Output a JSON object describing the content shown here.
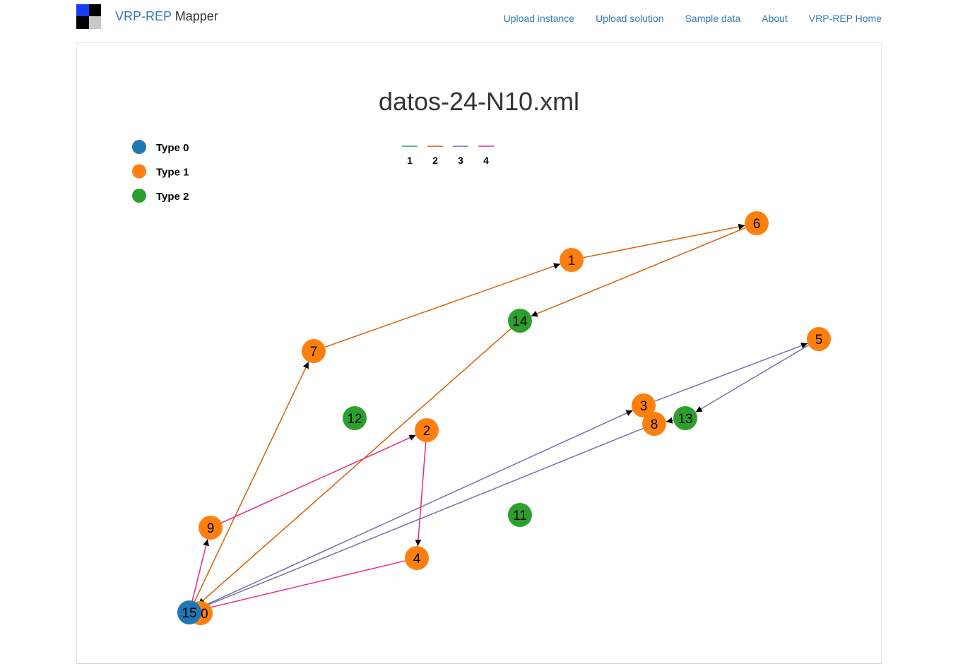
{
  "brand": {
    "part1": "VRP-REP",
    "part2": "Mapper"
  },
  "nav": [
    "Upload instance",
    "Upload solution",
    "Sample data",
    "About",
    "VRP-REP Home"
  ],
  "title": "datos-24-N10.xml",
  "node_legend": [
    {
      "label": "Type 0",
      "color": "#1f77b4"
    },
    {
      "label": "Type 1",
      "color": "#ff7f0e"
    },
    {
      "label": "Type 2",
      "color": "#2ca02c"
    }
  ],
  "route_legend": [
    {
      "label": "1",
      "color": "#1b9e77"
    },
    {
      "label": "2",
      "color": "#d95f02"
    },
    {
      "label": "3",
      "color": "#7570b3"
    },
    {
      "label": "4",
      "color": "#e7298a"
    }
  ],
  "nodes": [
    {
      "id": "1",
      "type": 1
    },
    {
      "id": "2",
      "type": 1
    },
    {
      "id": "3",
      "type": 1
    },
    {
      "id": "4",
      "type": 1
    },
    {
      "id": "5",
      "type": 1
    },
    {
      "id": "6",
      "type": 1
    },
    {
      "id": "7",
      "type": 1
    },
    {
      "id": "8",
      "type": 1
    },
    {
      "id": "9",
      "type": 1
    },
    {
      "id": "10",
      "type": 1
    },
    {
      "id": "11",
      "type": 2
    },
    {
      "id": "12",
      "type": 2
    },
    {
      "id": "13",
      "type": 2
    },
    {
      "id": "14",
      "type": 2
    },
    {
      "id": "15",
      "type": 0
    }
  ],
  "routes": [
    {
      "route": "2",
      "path": [
        "15",
        "7",
        "1",
        "6",
        "14",
        "15"
      ]
    },
    {
      "route": "3",
      "path": [
        "15",
        "3",
        "5",
        "13",
        "8",
        "15"
      ]
    },
    {
      "route": "4",
      "path": [
        "15",
        "9",
        "2",
        "4",
        "15"
      ]
    }
  ]
}
